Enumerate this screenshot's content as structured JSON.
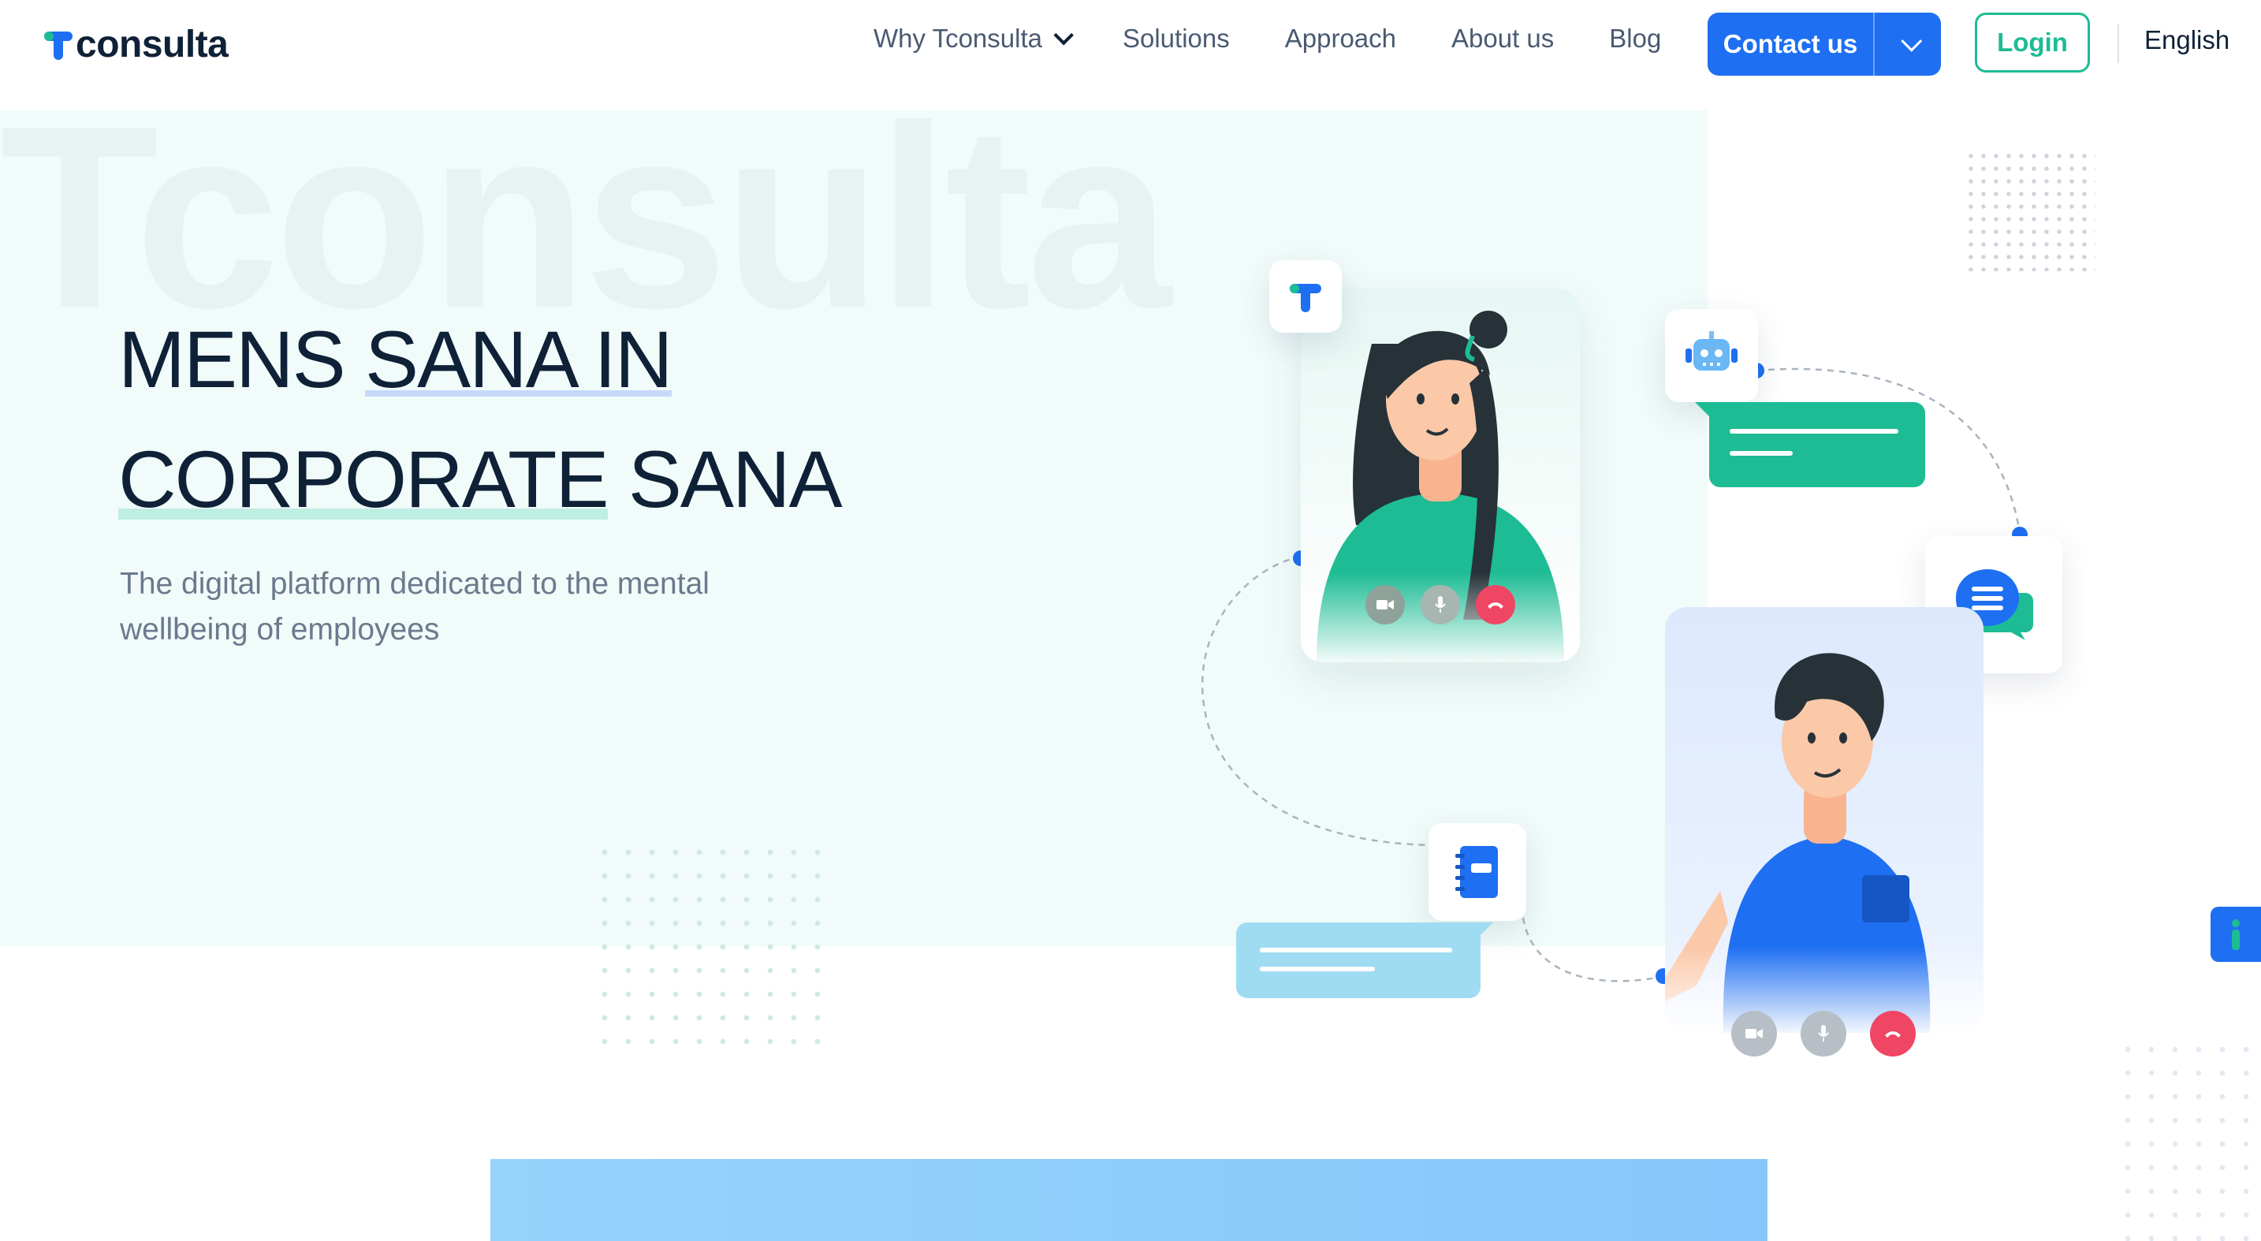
{
  "brand": {
    "name": "consulta",
    "colors": {
      "primary": "#1e6ff2",
      "accent": "#1dbc94",
      "text": "#0f2137"
    }
  },
  "nav": {
    "items": [
      {
        "label": "Why Tconsulta",
        "has_dropdown": true
      },
      {
        "label": "Solutions"
      },
      {
        "label": "Approach"
      },
      {
        "label": "About us"
      },
      {
        "label": "Blog"
      }
    ],
    "contact_label": "Contact us",
    "login_label": "Login",
    "language": "English"
  },
  "hero": {
    "watermark": "Tconsulta",
    "headline_line1_a": "MENS ",
    "headline_line1_b": "SANA IN",
    "headline_line2_a": "CORPORATE",
    "headline_line2_b": " SANA",
    "subtitle": "The digital platform dedicated to the mental wellbeing of employees"
  },
  "illustration": {
    "icons": [
      "tconsulta-logo-icon",
      "robot-icon",
      "chat-icon",
      "notebook-icon"
    ],
    "call_controls": [
      "video-icon",
      "microphone-icon",
      "hang-up-icon"
    ]
  }
}
